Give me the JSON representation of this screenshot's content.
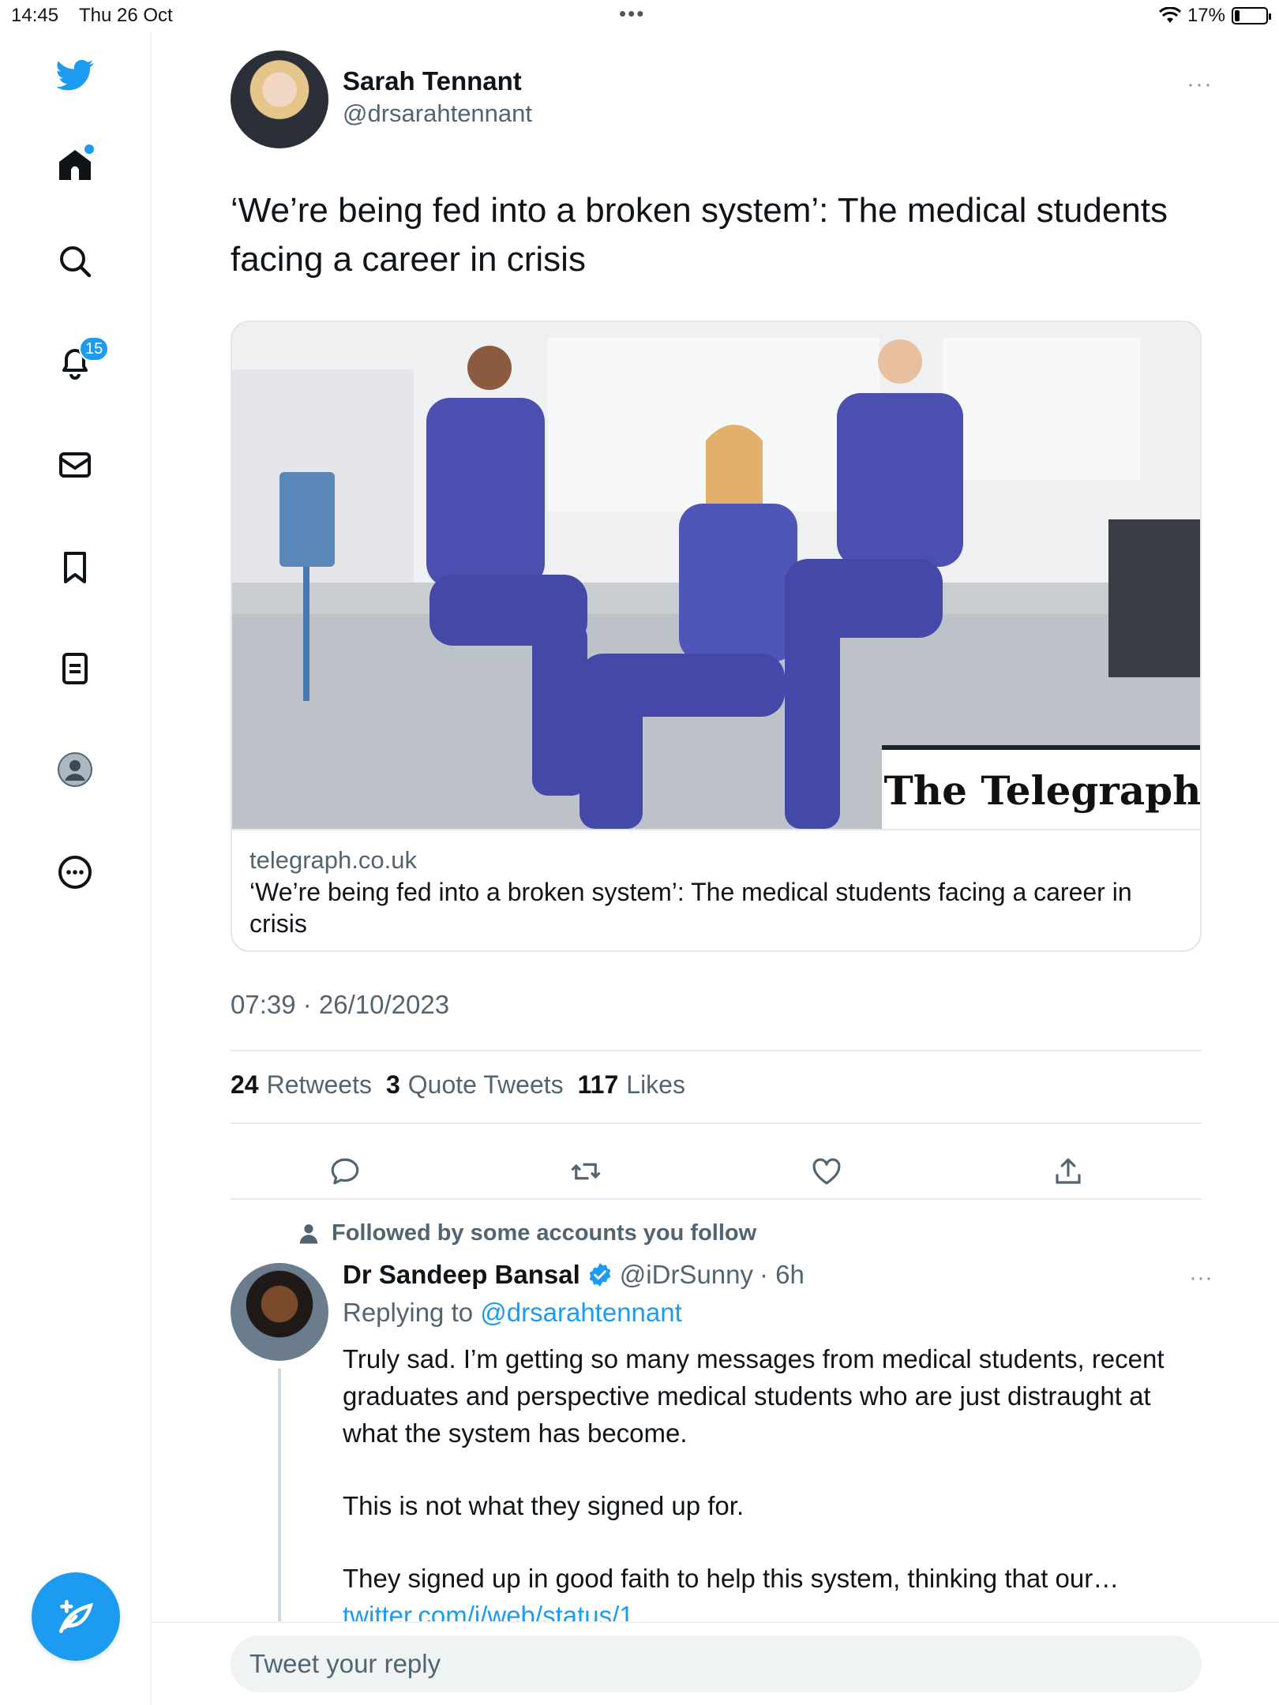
{
  "status_bar": {
    "time": "14:45",
    "date": "Thu 26 Oct",
    "battery": "17%"
  },
  "sidebar": {
    "notifications_badge": "15",
    "items": [
      "twitter-logo",
      "home",
      "search",
      "notifications",
      "messages",
      "bookmarks",
      "lists",
      "profile",
      "more"
    ]
  },
  "tweet": {
    "author_name": "Sarah Tennant",
    "author_handle": "@drsarahtennant",
    "more": "···",
    "text": "‘We’re being fed into a broken system’: The medical students facing a career in crisis",
    "card": {
      "brand_overlay": "The Telegraph",
      "domain": "telegraph.co.uk",
      "title": "‘We’re being fed into a broken system’: The medical students facing a career in crisis"
    },
    "timestamp": "07:39 · 26/10/2023",
    "stats": [
      {
        "count": "24",
        "label": "Retweets"
      },
      {
        "count": "3",
        "label": "Quote Tweets"
      },
      {
        "count": "117",
        "label": "Likes"
      }
    ]
  },
  "reply": {
    "context": "Followed by some accounts you follow",
    "name": "Dr Sandeep Bansal",
    "handle": "@iDrSunny",
    "time": "· 6h",
    "more": "···",
    "replying_to_prefix": "Replying to",
    "replying_to_handle": "@drsarahtennant",
    "paragraphs": [
      "Truly sad. I’m getting so many messages from medical students, recent graduates and perspective medical students who are just distraught at what the system has become.",
      "This is not what they signed up for.",
      "They signed up in good faith to help this system, thinking that our…"
    ],
    "link": "twitter.com/i/web/status/1…"
  },
  "reply_bar": {
    "placeholder": "Tweet your reply"
  },
  "colors": {
    "accent": "#1d9bf0",
    "text": "#0f1419",
    "secondary": "#536471",
    "border": "#e1e8ed"
  }
}
